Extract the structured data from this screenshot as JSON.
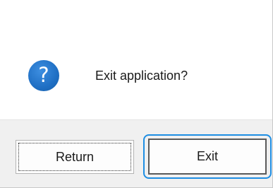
{
  "dialog": {
    "message": "Exit application?",
    "icon": "question-icon",
    "icon_glyph": "?",
    "accent_color": "#1f6fc4",
    "focus_color": "#1e8ee3"
  },
  "buttons": {
    "return_label": "Return",
    "exit_label": "Exit"
  }
}
